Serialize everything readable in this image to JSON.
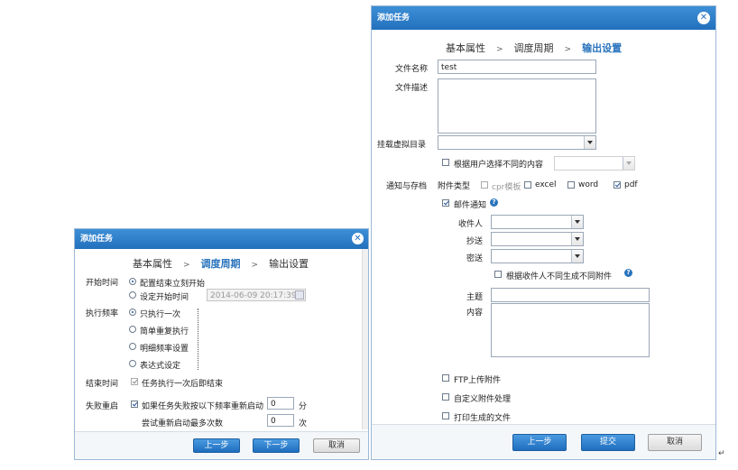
{
  "dialog_left": {
    "title": "添加任务",
    "steps": [
      "基本属性",
      "调度周期",
      "输出设置"
    ],
    "active_step": 1,
    "start_time": {
      "label": "开始时间",
      "opt1": "配置结束立刻开始",
      "opt2": "设定开始时间",
      "datetime": "2014-06-09 20:17:39"
    },
    "frequency": {
      "label": "执行频率",
      "opts": [
        "只执行一次",
        "简单重复执行",
        "明细频率设置",
        "表达式设定"
      ]
    },
    "end_time": {
      "label": "结束时间",
      "opt": "任务执行一次后即结束"
    },
    "retry": {
      "label": "失败重启",
      "opt": "如果任务失败按以下频率重新启动",
      "interval_value": "0",
      "interval_unit": "分",
      "max_label": "尝试重新启动最多次数",
      "max_value": "0",
      "max_unit": "次"
    },
    "buttons": {
      "prev": "上一步",
      "next": "下一步",
      "cancel": "取消"
    }
  },
  "dialog_right": {
    "title": "添加任务",
    "steps": [
      "基本属性",
      "调度周期",
      "输出设置"
    ],
    "active_step": 2,
    "file_name_label": "文件名称",
    "file_name_value": "test",
    "file_desc_label": "文件描述",
    "mount_dir_label": "挂载虚拟目录",
    "by_user_choice": "根据用户选择不同的内容",
    "notify_label": "通知与存档",
    "attach_type_label": "附件类型",
    "attach_types": [
      {
        "label": "cpr模板",
        "checked": false,
        "disabled": true
      },
      {
        "label": "excel",
        "checked": false,
        "disabled": false
      },
      {
        "label": "word",
        "checked": false,
        "disabled": false
      },
      {
        "label": "pdf",
        "checked": true,
        "disabled": false
      }
    ],
    "email_notify": "邮件通知",
    "recipient_label": "收件人",
    "cc_label": "抄送",
    "bcc_label": "密送",
    "per_recipient": "根据收件人不同生成不同附件",
    "subject_label": "主题",
    "content_label": "内容",
    "ftp_upload": "FTP上传附件",
    "custom_attach": "自定义附件处理",
    "print_file": "打印生成的文件",
    "buttons": {
      "prev": "上一步",
      "submit": "提交",
      "cancel": "取消"
    }
  },
  "return_mark": "↵"
}
